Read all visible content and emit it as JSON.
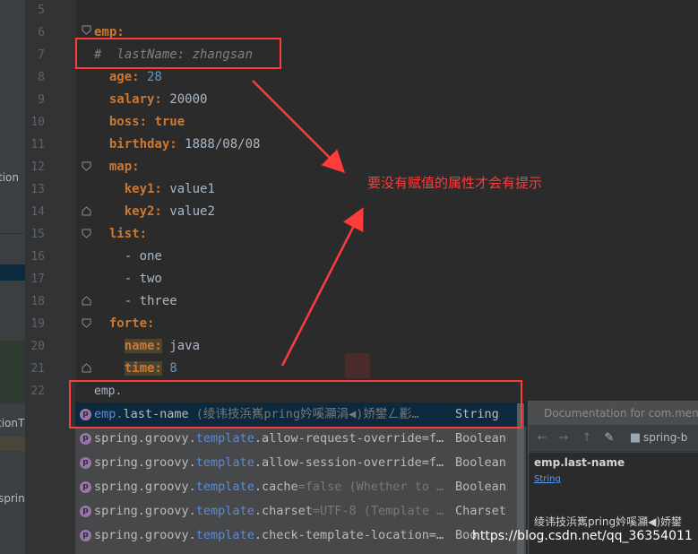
{
  "project_panel": {
    "fragments": [
      "tion",
      "tionT",
      "sprin"
    ]
  },
  "gutter": {
    "line_numbers": [
      "5",
      "6",
      "7",
      "8",
      "9",
      "10",
      "11",
      "12",
      "13",
      "14",
      "15",
      "16",
      "17",
      "18",
      "19",
      "20",
      "21",
      "22"
    ]
  },
  "editor": {
    "lines": [
      {
        "indent": "",
        "key": "emp:",
        "value": ""
      },
      {
        "indent": "",
        "comment": "#  lastName: zhangsan"
      },
      {
        "indent": "  ",
        "key": "age:",
        "value": " 28",
        "kind": "num"
      },
      {
        "indent": "  ",
        "key": "salary:",
        "value": " 20000",
        "kind": "plain"
      },
      {
        "indent": "  ",
        "key": "boss:",
        "value": " true",
        "kind": "bool"
      },
      {
        "indent": "  ",
        "key": "birthday:",
        "value": " 1888/08/08",
        "kind": "plain"
      },
      {
        "indent": "  ",
        "key": "map:",
        "value": ""
      },
      {
        "indent": "    ",
        "key": "key1:",
        "value": " value1",
        "kind": "plain"
      },
      {
        "indent": "    ",
        "key": "key2:",
        "value": " value2",
        "kind": "plain"
      },
      {
        "indent": "  ",
        "key": "list:",
        "value": ""
      },
      {
        "indent": "    ",
        "text": "- one"
      },
      {
        "indent": "    ",
        "text": "- two"
      },
      {
        "indent": "    ",
        "text": "- three"
      },
      {
        "indent": "  ",
        "key": "forte:",
        "value": ""
      },
      {
        "indent": "    ",
        "key": "name:",
        "value": " java",
        "kind": "plain"
      },
      {
        "indent": "    ",
        "key": "time:",
        "value": " 8",
        "kind": "num"
      }
    ]
  },
  "annotation": {
    "text": "要没有赋值的属性才会有提示",
    "color": "#ff3b3b"
  },
  "completion": {
    "input": "emp.",
    "items": [
      {
        "prefix": "emp.",
        "rest": "last-name",
        "detail": " (绫讳技浜嶲pring妗嗘灦涓◀)娇鐢ㄥ彲…",
        "type": "String",
        "selected": true
      },
      {
        "prefix": "spring.groovy.",
        "hit": "template",
        "rest": ".allow-request-override",
        "detail": "=f…",
        "type": "Boolean"
      },
      {
        "prefix": "spring.groovy.",
        "hit": "template",
        "rest": ".allow-session-override",
        "detail": "=f…",
        "type": "Boolean"
      },
      {
        "prefix": "spring.groovy.",
        "hit": "template",
        "rest": ".cache",
        "detail": "=false (Whether to …",
        "type": "Boolean"
      },
      {
        "prefix": "spring.groovy.",
        "hit": "template",
        "rest": ".charset",
        "detail": "=UTF-8 (Template …",
        "type": "Charset"
      },
      {
        "prefix": "spring.groovy.",
        "hit": "template",
        "rest": ".check-template-location",
        "detail": "=…",
        "type": "Boo"
      }
    ]
  },
  "documentation": {
    "title": "Documentation for com.meng",
    "breadcrumb": "spring-b",
    "heading": "emp.last-name",
    "type_link": "String",
    "description": "绫讳技浜嶲pring妗嗘灦◀)娇鐢"
  },
  "watermark": "https://blog.csdn.net/qq_36354011",
  "colors": {
    "editor_bg": "#2b2b2b",
    "key": "#cc7832",
    "number": "#6897bb",
    "comment": "#808080",
    "selection": "#0d293e"
  }
}
